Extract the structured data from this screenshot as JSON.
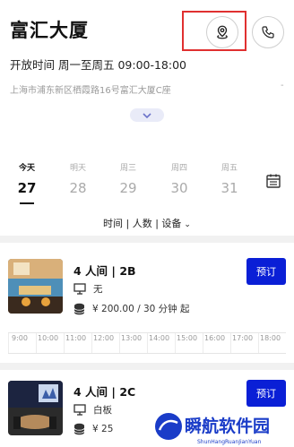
{
  "header": {
    "title": "富汇大厦",
    "location_icon": "map-pin-icon",
    "phone_icon": "phone-icon"
  },
  "info": {
    "hours": "开放时间 周一至周五 09:00-18:00",
    "address": "上海市浦东新区栖霞路16号富汇大厦C座",
    "address_more": "-"
  },
  "days": [
    {
      "label": "今天",
      "num": "27",
      "active": true
    },
    {
      "label": "明天",
      "num": "28",
      "active": false
    },
    {
      "label": "周三",
      "num": "29",
      "active": false
    },
    {
      "label": "周四",
      "num": "30",
      "active": false
    },
    {
      "label": "周五",
      "num": "31",
      "active": false
    }
  ],
  "filter": {
    "label": "时间 | 人数 | 设备"
  },
  "rooms": [
    {
      "title": "4 人间 | 2B",
      "equipment": "无",
      "price": "¥ 200.00 / 30 分钟 起",
      "book_label": "预订"
    },
    {
      "title": "4 人间 | 2C",
      "equipment": "白板",
      "price": "¥ 25",
      "book_label": "预订"
    }
  ],
  "timeline": [
    "9:00",
    "10:00",
    "11:00",
    "12:00",
    "13:00",
    "14:00",
    "15:00",
    "16:00",
    "17:00",
    "18:00"
  ],
  "watermark": {
    "text": "瞬航软件园",
    "sub": "ShunHangRuanJianYuan"
  }
}
